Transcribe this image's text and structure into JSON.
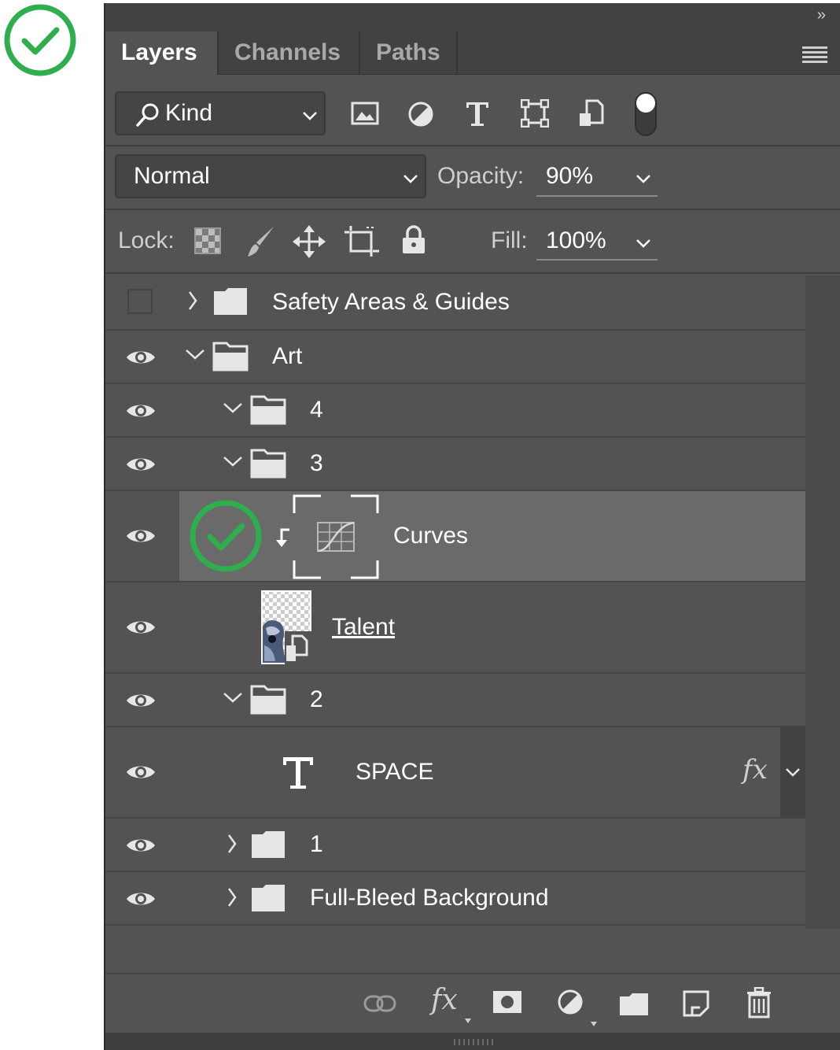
{
  "panel": {
    "tabs": [
      {
        "label": "Layers",
        "active": true
      },
      {
        "label": "Channels",
        "active": false
      },
      {
        "label": "Paths",
        "active": false
      }
    ],
    "collapse_glyph": "››",
    "filter": {
      "kind_label": "Kind",
      "filter_icons": [
        "image-filter-icon",
        "adjustment-filter-icon",
        "type-filter-icon",
        "shape-filter-icon",
        "smart-object-filter-icon",
        "filter-toggle-switch"
      ]
    },
    "blend": {
      "mode": "Normal",
      "opacity_label": "Opacity:",
      "opacity_value": "90%"
    },
    "lock": {
      "label": "Lock:",
      "fill_label": "Fill:",
      "fill_value": "100%"
    },
    "layers": [
      {
        "name": "Safety Areas & Guides",
        "type": "group",
        "visible": false,
        "expanded": false,
        "depth": 0
      },
      {
        "name": "Art",
        "type": "group",
        "visible": true,
        "expanded": true,
        "depth": 0
      },
      {
        "name": "4",
        "type": "group",
        "visible": true,
        "expanded": true,
        "depth": 1
      },
      {
        "name": "3",
        "type": "group",
        "visible": true,
        "expanded": true,
        "depth": 1
      },
      {
        "name": "Curves",
        "type": "adjustment",
        "visible": true,
        "selected": true,
        "clipped": true
      },
      {
        "name": "Talent",
        "type": "smart-object",
        "visible": true
      },
      {
        "name": "2",
        "type": "group",
        "visible": true,
        "expanded": true,
        "depth": 1
      },
      {
        "name": "SPACE",
        "type": "text",
        "visible": true,
        "effects": "fx"
      },
      {
        "name": "1",
        "type": "group",
        "visible": true,
        "expanded": false,
        "depth": 1
      },
      {
        "name": "Full-Bleed Background",
        "type": "group",
        "visible": true,
        "expanded": false,
        "depth": 1
      }
    ],
    "footer_icons": [
      "link-layers-icon",
      "layer-style-fx-icon",
      "add-mask-icon",
      "new-adjustment-icon",
      "new-group-icon",
      "new-layer-icon",
      "delete-layer-icon"
    ],
    "colors": {
      "panel_bg": "#535353",
      "selected_bg": "#6a6a6a",
      "check_green": "#2fae4e"
    }
  }
}
